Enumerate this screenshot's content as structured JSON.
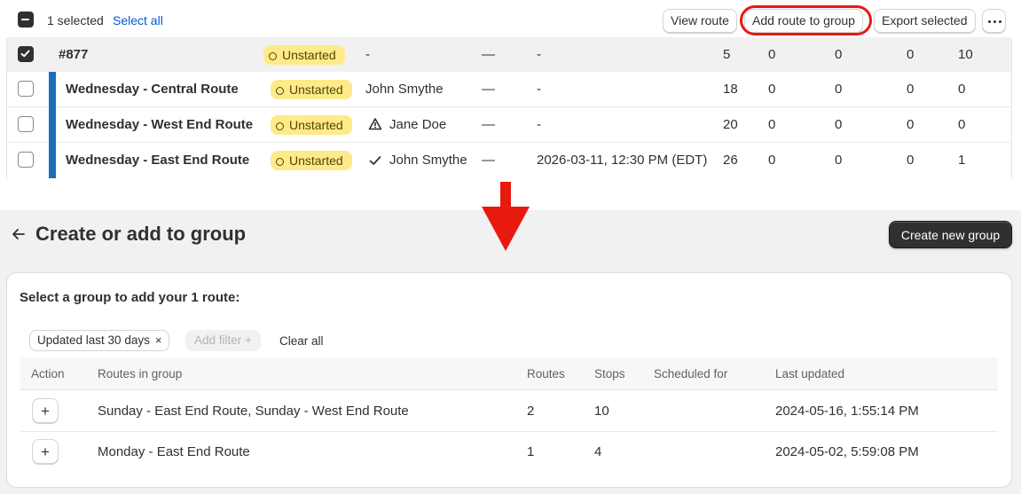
{
  "bulk": {
    "selected_text": "1 selected",
    "select_all": "Select all",
    "view_route": "View route",
    "add_route_to_group": "Add route to group",
    "export_selected": "Export selected"
  },
  "routes": [
    {
      "name": "#877",
      "status": "Unstarted",
      "driver": "-",
      "dash": "—",
      "scheduled": "-",
      "stops": "5",
      "c1": "0",
      "c2": "0",
      "c3": "0",
      "c4": "10",
      "checked": true
    },
    {
      "name": "Wednesday - Central Route",
      "status": "Unstarted",
      "driver": "John Smythe",
      "dash": "—",
      "scheduled": "-",
      "stops": "18",
      "c1": "0",
      "c2": "0",
      "c3": "0",
      "c4": "0",
      "checked": false
    },
    {
      "name": "Wednesday - West End Route",
      "status": "Unstarted",
      "driver": "Jane Doe",
      "dash": "—",
      "scheduled": "-",
      "stops": "20",
      "c1": "0",
      "c2": "0",
      "c3": "0",
      "c4": "0",
      "checked": false
    },
    {
      "name": "Wednesday - East End Route",
      "status": "Unstarted",
      "driver": "John Smythe",
      "dash": "—",
      "scheduled": "2026-03-11, 12:30 PM (EDT)",
      "stops": "26",
      "c1": "0",
      "c2": "0",
      "c3": "0",
      "c4": "1",
      "checked": false
    }
  ],
  "colors": {
    "accent_red": "#e8190f",
    "link_blue": "#005bd3",
    "route_bar_blue": "#1a6fbd",
    "badge_yellow": "#ffea8a"
  },
  "group_page": {
    "title": "Create or add to group",
    "create_button": "Create new group",
    "prompt": "Select a group to add your 1 route:",
    "filter_chip": "Updated last 30 days",
    "filter_chip_remove": "×",
    "add_filter": "Add filter +",
    "clear_all": "Clear all",
    "columns": [
      "Action",
      "Routes in group",
      "Routes",
      "Stops",
      "Scheduled for",
      "Last updated"
    ],
    "rows": [
      {
        "action": "+",
        "routes_in_group": "Sunday - East End Route, Sunday - West End Route",
        "routes": "2",
        "stops": "10",
        "scheduled_for": "",
        "last_updated": "2024-05-16, 1:55:14 PM"
      },
      {
        "action": "+",
        "routes_in_group": "Monday - East End Route",
        "routes": "1",
        "stops": "4",
        "scheduled_for": "",
        "last_updated": "2024-05-02, 5:59:08 PM"
      }
    ]
  }
}
